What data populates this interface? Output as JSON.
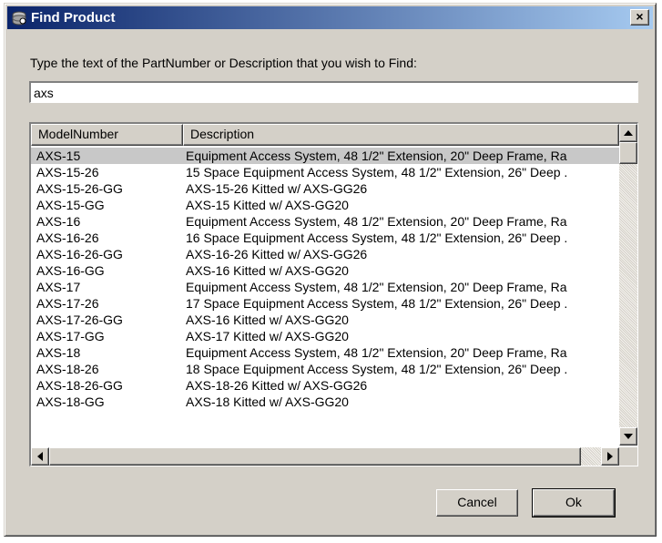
{
  "window": {
    "title": "Find Product",
    "app_icon": "product-db-icon",
    "close_label": "×"
  },
  "prompt": "Type the text of the PartNumber or Description that you wish to Find:",
  "search": {
    "value": "axs",
    "placeholder": ""
  },
  "list": {
    "columns": [
      "ModelNumber",
      "Description"
    ],
    "selected_index": 0,
    "rows": [
      {
        "model": "AXS-15",
        "description": "Equipment Access System, 48 1/2\" Extension, 20\" Deep Frame, Ra"
      },
      {
        "model": "AXS-15-26",
        "description": "15 Space Equipment Access System, 48 1/2\" Extension, 26\" Deep ."
      },
      {
        "model": "AXS-15-26-GG",
        "description": "AXS-15-26 Kitted w/ AXS-GG26"
      },
      {
        "model": "AXS-15-GG",
        "description": "AXS-15 Kitted w/ AXS-GG20"
      },
      {
        "model": "AXS-16",
        "description": "Equipment Access System, 48 1/2\" Extension, 20\" Deep Frame, Ra"
      },
      {
        "model": "AXS-16-26",
        "description": "16 Space Equipment Access System, 48 1/2\" Extension, 26\" Deep ."
      },
      {
        "model": "AXS-16-26-GG",
        "description": "AXS-16-26 Kitted w/ AXS-GG26"
      },
      {
        "model": "AXS-16-GG",
        "description": "AXS-16 Kitted w/ AXS-GG20"
      },
      {
        "model": "AXS-17",
        "description": "Equipment Access System, 48 1/2\" Extension, 20\" Deep Frame, Ra"
      },
      {
        "model": "AXS-17-26",
        "description": "17 Space Equipment Access System, 48 1/2\" Extension, 26\" Deep ."
      },
      {
        "model": "AXS-17-26-GG",
        "description": "AXS-16 Kitted w/ AXS-GG20"
      },
      {
        "model": "AXS-17-GG",
        "description": "AXS-17 Kitted w/ AXS-GG20"
      },
      {
        "model": "AXS-18",
        "description": "Equipment Access System, 48 1/2\" Extension, 20\" Deep Frame, Ra"
      },
      {
        "model": "AXS-18-26",
        "description": "18 Space Equipment Access System, 48 1/2\" Extension, 26\" Deep ."
      },
      {
        "model": "AXS-18-26-GG",
        "description": "AXS-18-26 Kitted w/ AXS-GG26"
      },
      {
        "model": "AXS-18-GG",
        "description": "AXS-18 Kitted w/ AXS-GG20"
      }
    ]
  },
  "buttons": {
    "cancel": "Cancel",
    "ok": "Ok"
  },
  "colors": {
    "titlebar_start": "#0a246a",
    "titlebar_end": "#a6caf0",
    "dialog_face": "#d4d0c8",
    "selected_row": "#c8c8c8"
  }
}
